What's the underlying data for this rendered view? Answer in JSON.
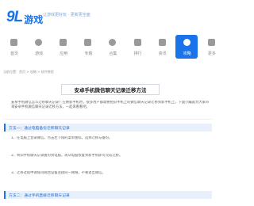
{
  "header": {
    "logo_num": "9L",
    "logo_text": "游戏",
    "slogan": "让游戏更好玩 · 更新更全面"
  },
  "nav": [
    {
      "label": "首页",
      "icon": "home-icon",
      "active": false
    },
    {
      "label": "游戏",
      "icon": "gamepad-icon",
      "active": false
    },
    {
      "label": "应用",
      "icon": "apps-icon",
      "active": false
    },
    {
      "label": "专题",
      "icon": "topic-icon",
      "active": false
    },
    {
      "label": "合集",
      "icon": "collection-icon",
      "active": false
    },
    {
      "label": "排行",
      "icon": "rank-icon",
      "active": false
    },
    {
      "label": "资讯",
      "icon": "news-icon",
      "active": false
    },
    {
      "label": "攻略",
      "icon": "guide-icon",
      "active": true
    },
    {
      "label": "更多",
      "icon": "more-icon",
      "active": false
    }
  ],
  "breadcrumb": "当前位置：首页 > 攻略 > 软件教程",
  "article": {
    "title": "安卓手机微信聊天记录迁移方法",
    "intro": "安卓手机微信怎么迁移聊天记录？在换新手机时，很多用户都需要把旧手机上的微信聊天记录迁移到新手机上，下面小编就为大家带来安卓手机微信聊天记录迁移方法，一起来看看吧。",
    "section1_title": "方法一：通过电脑备份迁移聊天记录",
    "section1_p1": "1、在电脑上登录微信，点击左下角的菜单图标，选择迁移与备份。",
    "section1_p2": "2、将旧手机聊天记录备份到电脑，再从电脑恢复到新手机即可完成迁移。",
    "section1_p3": "3、迁移过程中请保持两台设备连接同一网络，不要退出微信。",
    "section2_title": "方法二：通过手机直接迁移聊天记录"
  }
}
